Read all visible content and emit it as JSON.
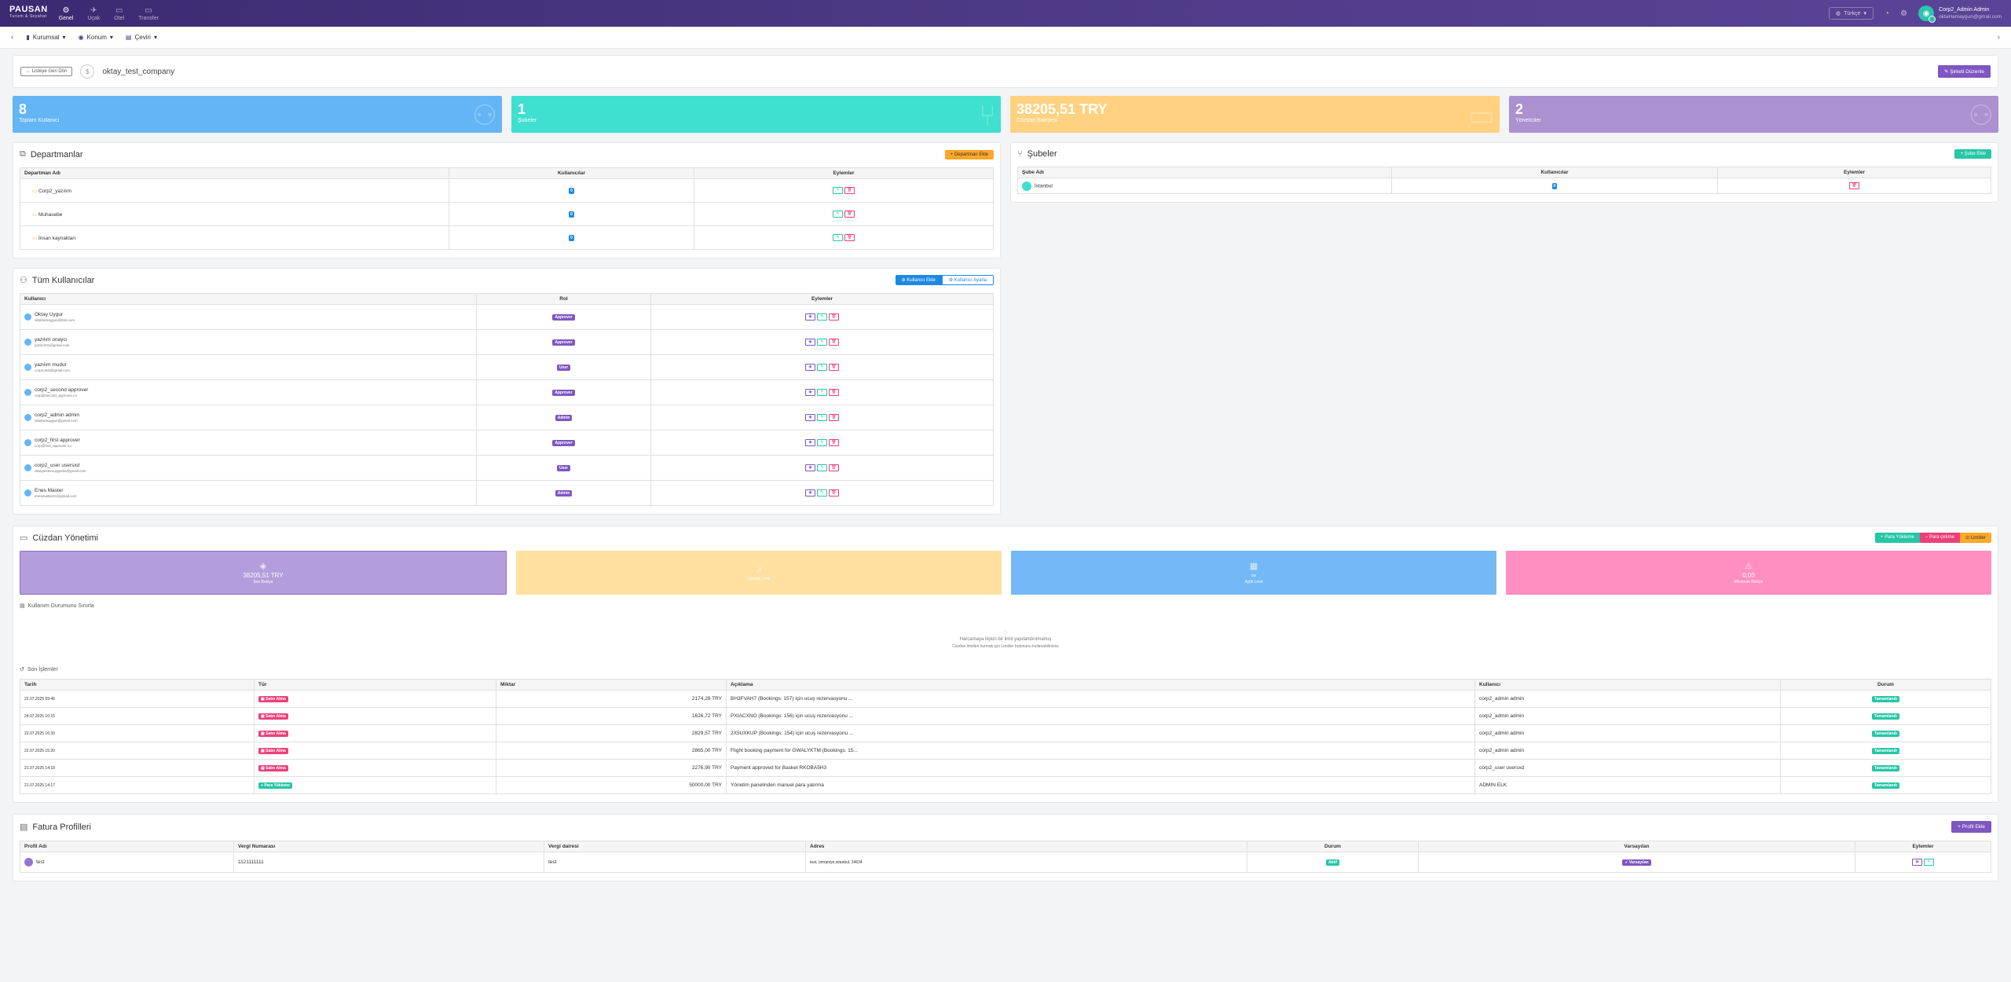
{
  "topbar": {
    "logo": "PAUSAN",
    "logo_sub": "Turizm & Seyahat",
    "nav": [
      {
        "label": "Genel",
        "icon": "gear-icon",
        "glyph": "⚙"
      },
      {
        "label": "Uçak",
        "icon": "plane-icon",
        "glyph": "✈"
      },
      {
        "label": "Otel",
        "icon": "bed-icon",
        "glyph": "▭"
      },
      {
        "label": "Transfer",
        "icon": "car-icon",
        "glyph": "▭"
      }
    ],
    "language": "Türkçe",
    "user_name": "Corp2_Admin Admin",
    "user_email": "oktaHamaygun@gmail.com"
  },
  "subbar": {
    "crumbs": [
      "Kurumsal",
      "Konum",
      "Çeviri"
    ]
  },
  "company": {
    "back_label": "← Listeye Geri Dön",
    "name": "oktay_test_company",
    "edit_label": "Şirketi Düzenle"
  },
  "stats": [
    {
      "value": "8",
      "label": "Toplam Kullanıcı",
      "color": "#64b5f6"
    },
    {
      "value": "1",
      "label": "Şubeler",
      "color": "#40e0d0"
    },
    {
      "value": "38205,51 TRY",
      "label": "Cüzdan Bakiyesi",
      "color": "#ffd180"
    },
    {
      "value": "2",
      "label": "Yöneticiler",
      "color": "#ab91d0"
    }
  ],
  "departments": {
    "title": "Departmanlar",
    "add_label": "+ Departman Ekle",
    "columns": [
      "Departman Adı",
      "Kullanıcılar",
      "Eylemler"
    ],
    "rows": [
      {
        "name": "Corp2_yazılım",
        "users": "0"
      },
      {
        "name": "Muhasebe",
        "users": "0"
      },
      {
        "name": "İnsan kaynakları",
        "users": "0"
      }
    ]
  },
  "branches": {
    "title": "Şubeler",
    "add_label": "+ Şube Ekle",
    "columns": [
      "Şube Adı",
      "Kullanıcılar",
      "Eylemler"
    ],
    "rows": [
      {
        "name": "İstanbul",
        "users": "0"
      }
    ]
  },
  "users": {
    "title": "Tüm Kullanıcılar",
    "add_label": "Kullanıcı Ekle",
    "assign_label": "Kullanıcı Ayarla",
    "columns": [
      "Kullanıcı",
      "Rol",
      "Eylemler"
    ],
    "rows": [
      {
        "name": "Oktay Uygur",
        "email": "oktahamaygun@test.com",
        "role": "Approver"
      },
      {
        "name": "yazılım onaycı",
        "email": "yazılım01@gmail.com",
        "role": "Approver"
      },
      {
        "name": "yazılım mudur",
        "email": "corp2.test@gmail.com",
        "role": "User"
      },
      {
        "name": "corp2_second approver",
        "email": "corp@second_approver.co",
        "role": "Approver"
      },
      {
        "name": "corp2_admin admin",
        "email": "oktahamaygun@gmail.com",
        "role": "Admin"
      },
      {
        "name": "corp2_first approver",
        "email": "corp@first_approver.co",
        "role": "Approver"
      },
      {
        "name": "corp2_user usersxd",
        "email": "oktaytestersuygur94@gmail.com",
        "role": "User"
      },
      {
        "name": "Enes Master",
        "email": "enesmaster01@gmail.com",
        "role": "Admin"
      }
    ]
  },
  "wallet": {
    "title": "Cüzdan Yönetimi",
    "deposit_label": "+ Para Yükleme",
    "withdraw_label": "− Para çekme",
    "limits_label": "⊙ Limitler",
    "cards": [
      {
        "value": "38205,51 TRY",
        "label": "Son Bakiye",
        "color": "#b39ddb",
        "icon": "wallet-icon",
        "glyph": "◈"
      },
      {
        "value": "",
        "label": "Günlük Limit",
        "color": "#ffe0a0",
        "icon": "trend-icon",
        "glyph": "⇗"
      },
      {
        "value": "∞",
        "label": "Aylık Limit",
        "color": "#74b9f6",
        "icon": "calendar-icon",
        "glyph": "▦"
      },
      {
        "value": "0,00",
        "label": "Minimum Bakiye",
        "color": "#ff8fc0",
        "icon": "warning-icon",
        "glyph": "⚠"
      }
    ],
    "usage_title": "Kullanım Durumunu Sınırla",
    "empty_line1": "Harcamaya ilişkin bir limit yapılandırılmamış",
    "empty_line2": "Cüzdan limitleri kurmak için Limitler butonunu kullanabilirsiniz",
    "tx_title": "Son İşlemler",
    "tx_columns": [
      "Tarih",
      "Tür",
      "Miktar",
      "Açıklama",
      "Kullanıcı",
      "Durum"
    ],
    "tx_rows": [
      {
        "date": "22.07.2025 09:46",
        "type": "Satın Alma",
        "type_color": "pink",
        "amount": "2174,28 TRY",
        "desc": "BH3FVAH7 (Bookings: 157) için ucuş rezervasyonu ...",
        "user": "corp2_admin admin",
        "status": "Tamamlandı"
      },
      {
        "date": "24.07.2025 10:15",
        "type": "Satın Alma",
        "type_color": "pink",
        "amount": "1626,72 TRY",
        "desc": "PXIACXNO (Bookings: 156) için ucuş rezervasyonu ...",
        "user": "corp2_admin admin",
        "status": "Tamamlandı"
      },
      {
        "date": "22.07.2025 16:30",
        "type": "Satın Alma",
        "type_color": "pink",
        "amount": "2829,57 TRY",
        "desc": "2X5UXKUP (Bookings: 154) için ucuş rezervasyonu ...",
        "user": "corp2_admin admin",
        "status": "Tamamlandı"
      },
      {
        "date": "22.07.2025 15:20",
        "type": "Satın Alma",
        "type_color": "pink",
        "amount": "2865,00 TRY",
        "desc": "Flight booking payment for GWALYKTM (Bookings: 15...",
        "user": "corp2_admin admin",
        "status": "Tamamlandı"
      },
      {
        "date": "21.07.2025 14:18",
        "type": "Satın Alma",
        "type_color": "pink",
        "amount": "2276,90 TRY",
        "desc": "Payment approved for Basket RKOBA5H3",
        "user": "corp2_user usersxd",
        "status": "Tamamlandı"
      },
      {
        "date": "21.07.2025 14:17",
        "type": "Para Yükleme",
        "type_color": "teal",
        "amount": "50000,00 TRY",
        "desc": "Yönetim panelinden manuel para yatırma",
        "user": "ADMIN ELK",
        "status": "Tamamlandı"
      }
    ]
  },
  "invoice": {
    "title": "Fatura Profilleri",
    "add_label": "+ Profil Ekle",
    "columns": [
      "Profil Adı",
      "Vergi Numarası",
      "Vergi dairesi",
      "Adres",
      "Durum",
      "Varsayılan",
      "Eylemler"
    ],
    "rows": [
      {
        "name": "test",
        "tax_no": "1121111111",
        "tax_office": "test",
        "address": "test, ümraniye,istanbul, 34634",
        "status": "Aktif",
        "default": "✓ Varsayılan"
      }
    ]
  }
}
